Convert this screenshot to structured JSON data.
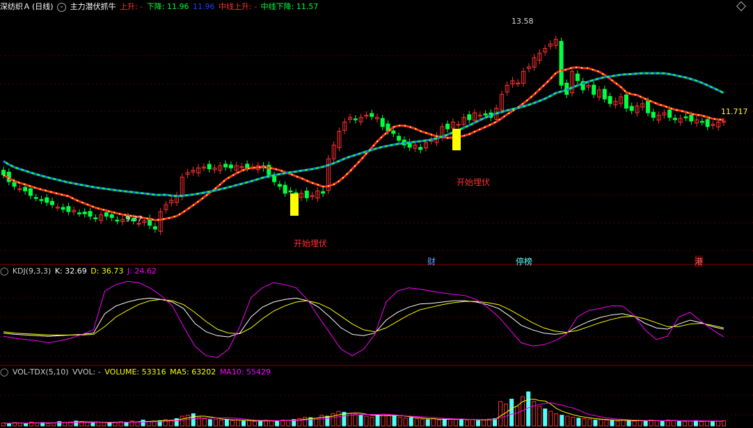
{
  "main_header": {
    "stock": "深纺织Ａ",
    "period": "(日线)",
    "indicator": "主力潜伏抓牛",
    "up_label": "上升: -",
    "down_label": "下降: 11.96",
    "blue_value": "11.96",
    "mid_up_label": "中线上升: -",
    "mid_down_label": "中线下降: 11.57"
  },
  "kdj_header": {
    "name": "KDJ(9,3,3)",
    "k": "K: 32.69",
    "d": "D: 36.73",
    "j": "J: 24.62"
  },
  "vol_header": {
    "name": "VOL-TDX(5,10)",
    "vvol": "VVOL: -",
    "volume": "VOLUME: 53316",
    "ma5": "MA5: 63202",
    "ma10": "MA10: 55429"
  },
  "annotations": {
    "high": "13.58",
    "low": "9.37",
    "last": "11.717",
    "ambush1": "开始埋伏",
    "ambush2": "开始埋伏",
    "tag_cai": "财",
    "tag_ting": "停榜",
    "tag_gang": "港"
  },
  "colors": {
    "up": "#ff3030",
    "down": "#00ff40",
    "cyan": "#54fcfc",
    "yellow": "#ffff00",
    "magenta": "#ff00ff",
    "white": "#ffffff"
  },
  "chart_data": [
    {
      "type": "candlestick",
      "ylim": [
        8.6,
        13.9
      ],
      "closes": [
        10.55,
        10.4,
        10.3,
        10.25,
        10.2,
        10.1,
        10.05,
        10.0,
        9.95,
        9.9,
        9.85,
        9.8,
        9.75,
        9.78,
        9.72,
        9.7,
        9.65,
        9.6,
        9.68,
        9.65,
        9.62,
        9.55,
        9.58,
        9.6,
        9.55,
        9.5,
        9.55,
        9.45,
        9.37,
        9.75,
        9.9,
        10.0,
        10.1,
        10.5,
        10.6,
        10.65,
        10.7,
        10.72,
        10.68,
        10.7,
        10.75,
        10.72,
        10.7,
        10.75,
        10.73,
        10.7,
        10.72,
        10.75,
        10.7,
        10.55,
        10.4,
        10.3,
        10.15,
        10.2,
        10.1,
        10.15,
        10.05,
        10.1,
        10.2,
        10.15,
        10.9,
        11.2,
        11.5,
        11.7,
        11.8,
        11.75,
        11.8,
        11.85,
        11.82,
        11.8,
        11.6,
        11.5,
        11.45,
        11.3,
        11.2,
        11.15,
        11.2,
        11.1,
        11.25,
        11.3,
        11.4,
        11.6,
        11.55,
        11.7,
        11.65,
        11.8,
        11.75,
        11.9,
        11.85,
        11.85,
        11.8,
        12.0,
        12.3,
        12.5,
        12.6,
        12.55,
        12.8,
        12.9,
        13.1,
        13.2,
        13.3,
        13.4,
        13.5,
        12.5,
        12.3,
        12.8,
        12.6,
        12.4,
        12.5,
        12.3,
        12.4,
        12.2,
        12.1,
        12.15,
        12.25,
        12.0,
        11.95,
        12.05,
        12.1,
        11.9,
        11.8,
        11.85,
        11.9,
        11.8,
        11.75,
        11.78,
        11.8,
        11.72,
        11.75,
        11.7,
        11.6,
        11.65,
        11.7,
        11.717
      ],
      "ma_long": "descending green/cyan dashed lines",
      "high": 13.58,
      "low": 9.37
    },
    {
      "type": "line",
      "name": "KDJ(9,3,3)",
      "ylim": [
        -20,
        120
      ],
      "series": [
        {
          "name": "K",
          "values": [
            30,
            28,
            27,
            26,
            25,
            26,
            27,
            28,
            30,
            60,
            72,
            78,
            82,
            84,
            82,
            78,
            68,
            45,
            32,
            26,
            24,
            30,
            55,
            70,
            78,
            82,
            84,
            80,
            70,
            55,
            38,
            28,
            26,
            30,
            50,
            62,
            70,
            75,
            76,
            78,
            80,
            80,
            78,
            74,
            68,
            56,
            42,
            35,
            30,
            28,
            30,
            40,
            48,
            54,
            58,
            60,
            56,
            45,
            38,
            36,
            44,
            50,
            46,
            40,
            36
          ]
        },
        {
          "name": "D",
          "values": [
            32,
            30,
            29,
            28,
            27,
            27,
            27,
            27,
            28,
            40,
            55,
            65,
            74,
            80,
            82,
            80,
            74,
            62,
            48,
            36,
            30,
            29,
            38,
            52,
            64,
            72,
            78,
            80,
            76,
            68,
            56,
            44,
            35,
            32,
            38,
            48,
            58,
            66,
            70,
            74,
            77,
            79,
            79,
            77,
            74,
            66,
            56,
            46,
            38,
            33,
            31,
            34,
            40,
            46,
            51,
            55,
            56,
            52,
            46,
            40,
            40,
            44,
            45,
            42,
            38
          ]
        },
        {
          "name": "J",
          "values": [
            25,
            22,
            20,
            18,
            15,
            18,
            22,
            28,
            35,
            95,
            105,
            110,
            108,
            100,
            88,
            72,
            40,
            10,
            -5,
            -8,
            5,
            40,
            85,
            100,
            108,
            105,
            100,
            82,
            55,
            30,
            5,
            -5,
            5,
            28,
            78,
            95,
            100,
            98,
            95,
            92,
            90,
            88,
            82,
            70,
            55,
            35,
            15,
            10,
            12,
            18,
            28,
            55,
            65,
            68,
            72,
            72,
            58,
            35,
            20,
            25,
            55,
            62,
            48,
            35,
            24
          ]
        }
      ]
    },
    {
      "type": "bar",
      "name": "VOL-TDX(5,10)",
      "ylim": [
        0,
        100
      ],
      "values": [
        6,
        5,
        7,
        6,
        5,
        8,
        6,
        7,
        5,
        6,
        9,
        7,
        8,
        10,
        9,
        7,
        6,
        8,
        7,
        6,
        8,
        9,
        7,
        10,
        8,
        12,
        9,
        10,
        11,
        13,
        12,
        15,
        20,
        22,
        25,
        18,
        15,
        13,
        14,
        12,
        13,
        11,
        12,
        10,
        11,
        9,
        10,
        12,
        11,
        10,
        12,
        11,
        13,
        15,
        18,
        17,
        16,
        22,
        20,
        25,
        30,
        28,
        26,
        24,
        22,
        20,
        18,
        22,
        24,
        22,
        20,
        18,
        16,
        17,
        15,
        14,
        13,
        15,
        12,
        14,
        15,
        13,
        14,
        12,
        13,
        11,
        12,
        14,
        15,
        50,
        45,
        55,
        40,
        60,
        70,
        50,
        40,
        35,
        30,
        25,
        22,
        20,
        18,
        16,
        15,
        14,
        12,
        13,
        12,
        11,
        10,
        12,
        11,
        10,
        11,
        10,
        12,
        11,
        10,
        12,
        11,
        10,
        9,
        10,
        11,
        9,
        10,
        9,
        10,
        11
      ],
      "ma5": "yellow",
      "ma10": "magenta"
    }
  ]
}
